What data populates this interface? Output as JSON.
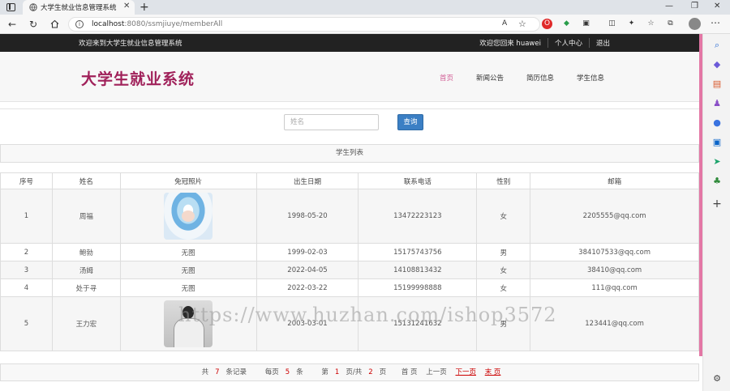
{
  "browser": {
    "tab_title": "大学生就业信息管理系统",
    "tab_close": "✕",
    "new_tab": "+",
    "url_host": "localhost",
    "url_rest": ":8080/ssmjiuye/memberAll",
    "read_aloud": "A",
    "win_min": "—",
    "win_max": "❐",
    "win_close": "✕"
  },
  "topbar": {
    "welcome": "欢迎来到大学生就业信息管理系统",
    "greeting": "欢迎您回来 huawei",
    "personal": "个人中心",
    "logout": "退出"
  },
  "header": {
    "logo": "大学生就业系统",
    "nav": [
      "首页",
      "新闻公告",
      "简历信息",
      "学生信息"
    ]
  },
  "search": {
    "placeholder": "姓名",
    "button": "查询"
  },
  "list_title": "学生列表",
  "table": {
    "headers": [
      "序号",
      "姓名",
      "免冠照片",
      "出生日期",
      "联系电话",
      "性别",
      "邮箱"
    ],
    "rows": [
      {
        "no": "1",
        "name": "周福",
        "photo": "",
        "birth": "1998-05-20",
        "phone": "13472223123",
        "gender": "女",
        "email": "2205555@qq.com"
      },
      {
        "no": "2",
        "name": "鲍勃",
        "photo": "无图",
        "birth": "1999-02-03",
        "phone": "15175743756",
        "gender": "男",
        "email": "384107533@qq.com"
      },
      {
        "no": "3",
        "name": "汤姆",
        "photo": "无图",
        "birth": "2022-04-05",
        "phone": "14108813432",
        "gender": "女",
        "email": "38410@qq.com"
      },
      {
        "no": "4",
        "name": "处于寻",
        "photo": "无图",
        "birth": "2022-03-22",
        "phone": "15199998888",
        "gender": "女",
        "email": "111@qq.com"
      },
      {
        "no": "5",
        "name": "王力宏",
        "photo": "",
        "birth": "2003-03-01",
        "phone": "15131241632",
        "gender": "男",
        "email": "123441@qq.com"
      }
    ]
  },
  "watermark": "https://www.huzhan.com/ishop3572",
  "pager": {
    "total_pre": "共",
    "total_num": "7",
    "total_post": "条记录",
    "per_pre": "每页",
    "per_num": "5",
    "per_post": "条",
    "page_pre": "第",
    "page_num": "1",
    "page_mid": "页/共",
    "page_total": "2",
    "page_post": "页",
    "first": "首 页",
    "prev": "上一页",
    "next": "下一页",
    "last": "末 页"
  },
  "colors": {
    "logo": "#a0215a",
    "nav_active": "#d25f96",
    "button": "#3b7fc4",
    "side_accent": "#e377a5"
  }
}
